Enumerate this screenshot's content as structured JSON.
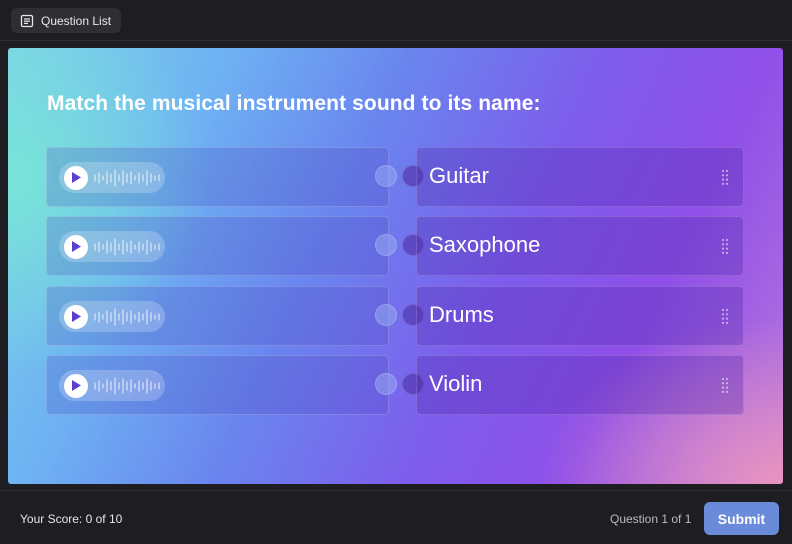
{
  "header": {
    "question_list_label": "Question List",
    "question_list_icon": "list-document-icon"
  },
  "question": {
    "prompt": "Match the musical instrument sound to its name:",
    "audio_clips": [
      {
        "icon": "play-icon"
      },
      {
        "icon": "play-icon"
      },
      {
        "icon": "play-icon"
      },
      {
        "icon": "play-icon"
      }
    ],
    "answers": [
      {
        "label": "Guitar",
        "icon": "drag-handle-icon"
      },
      {
        "label": "Saxophone",
        "icon": "drag-handle-icon"
      },
      {
        "label": "Drums",
        "icon": "drag-handle-icon"
      },
      {
        "label": "Violin",
        "icon": "drag-handle-icon"
      }
    ]
  },
  "footer": {
    "score": "Your Score: 0 of 10",
    "question_count": "Question 1 of 1",
    "submit_label": "Submit"
  },
  "colors": {
    "background": "#1e1e22",
    "submit": "#6a8bd9",
    "play_triangle": "#5b3fd1"
  }
}
